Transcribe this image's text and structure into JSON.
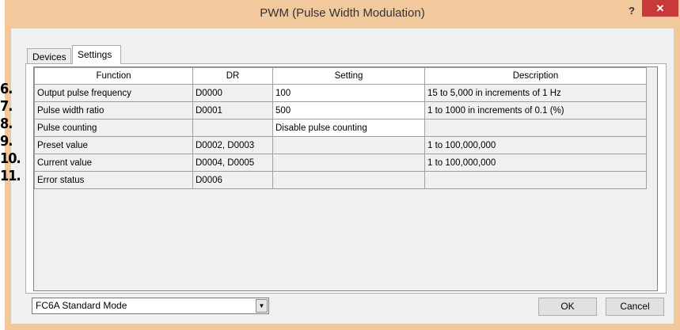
{
  "window": {
    "title": "PWM (Pulse Width Modulation)",
    "help_label": "?",
    "close_label": "✕"
  },
  "tabs": [
    {
      "label": "Devices"
    },
    {
      "label": "Settings"
    }
  ],
  "table": {
    "headers": [
      "Function",
      "DR",
      "Setting",
      "Description"
    ],
    "rows": [
      {
        "num": "6.",
        "function": "Output pulse frequency",
        "dr": "D0000",
        "setting": "100",
        "description": "15 to 5,000 in increments of 1 Hz"
      },
      {
        "num": "7.",
        "function": "Pulse width ratio",
        "dr": "D0001",
        "setting": "500",
        "description": "1 to 1000 in increments of 0.1 (%)"
      },
      {
        "num": "8.",
        "function": "Pulse counting",
        "dr": "",
        "setting": "Disable pulse counting",
        "description": ""
      },
      {
        "num": "9.",
        "function": "Preset value",
        "dr": "D0002, D0003",
        "setting": "",
        "description": "1 to 100,000,000"
      },
      {
        "num": "10.",
        "function": "Current value",
        "dr": "D0004, D0005",
        "setting": "",
        "description": "1 to 100,000,000"
      },
      {
        "num": "11.",
        "function": "Error status",
        "dr": "D0006",
        "setting": "",
        "description": ""
      }
    ]
  },
  "mode": {
    "selected": "FC6A Standard Mode"
  },
  "buttons": {
    "ok": "OK",
    "cancel": "Cancel"
  }
}
